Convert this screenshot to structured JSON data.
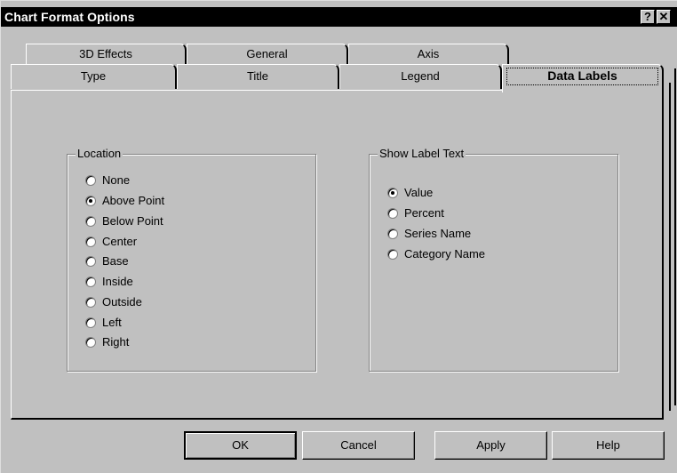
{
  "window": {
    "title": "Chart Format Options",
    "help_label": "?",
    "close_label": "✕"
  },
  "tabs": {
    "back_row": [
      {
        "label": "3D Effects"
      },
      {
        "label": "General"
      },
      {
        "label": "Axis"
      }
    ],
    "front_row": [
      {
        "label": "Type"
      },
      {
        "label": "Title"
      },
      {
        "label": "Legend"
      },
      {
        "label": "Data Labels",
        "active": true
      }
    ]
  },
  "location_group": {
    "label": "Location",
    "selected": "Above Point",
    "options": [
      "None",
      "Above Point",
      "Below Point",
      "Center",
      "Base",
      "Inside",
      "Outside",
      "Left",
      "Right"
    ]
  },
  "label_text_group": {
    "label": "Show Label Text",
    "selected": "Value",
    "options": [
      "Value",
      "Percent",
      "Series Name",
      "Category Name"
    ]
  },
  "buttons": {
    "ok": "OK",
    "cancel": "Cancel",
    "apply": "Apply",
    "help": "Help"
  }
}
